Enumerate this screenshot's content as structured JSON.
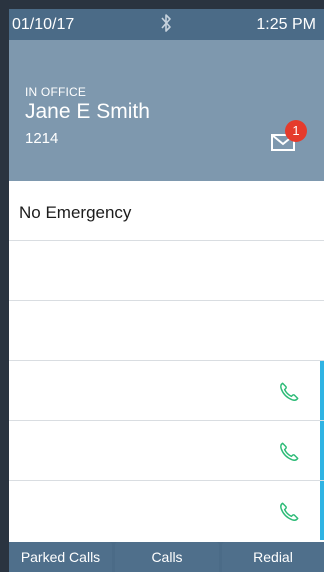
{
  "status_bar": {
    "date": "01/10/17",
    "time": "1:25 PM",
    "bluetooth_icon": "bluetooth-icon"
  },
  "header": {
    "presence": "IN OFFICE",
    "name": "Jane E Smith",
    "extension": "1214",
    "voicemail_icon": "envelope-icon",
    "voicemail_count": "1"
  },
  "lines": [
    {
      "label": "No Emergency",
      "phone_icon": false,
      "active": false
    },
    {
      "label": "",
      "phone_icon": false,
      "active": false
    },
    {
      "label": "",
      "phone_icon": false,
      "active": false
    },
    {
      "label": "",
      "phone_icon": true,
      "active": true
    },
    {
      "label": "",
      "phone_icon": true,
      "active": true
    },
    {
      "label": "",
      "phone_icon": true,
      "active": true
    }
  ],
  "softkeys": {
    "key1": "Parked Calls",
    "key2": "Calls",
    "key3": "Redial"
  },
  "colors": {
    "status_bar": "#4b6b87",
    "header": "#7e98ae",
    "badge": "#e53b2c",
    "phone_icon": "#2dbb77",
    "active_line": "#2fb3e3"
  }
}
